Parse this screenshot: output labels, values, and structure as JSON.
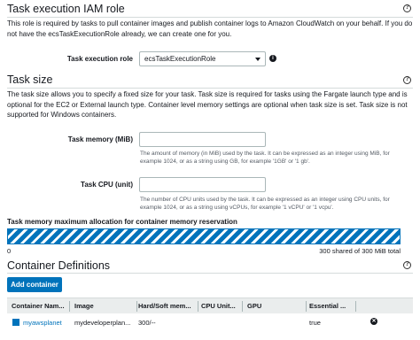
{
  "iam_section": {
    "title": "Task execution IAM role",
    "description": "This role is required by tasks to pull container images and publish container logs to Amazon CloudWatch on your behalf. If you do not have the ecsTaskExecutionRole already, we can create one for you.",
    "field_label": "Task execution role",
    "selected_value": "ecsTaskExecutionRole"
  },
  "task_size": {
    "title": "Task size",
    "description": "The task size allows you to specify a fixed size for your task. Task size is required for tasks using the Fargate launch type and is optional for the EC2 or External launch type. Container level memory settings are optional when task size is set. Task size is not supported for Windows containers.",
    "memory_label": "Task memory (MiB)",
    "memory_value": "",
    "memory_hint": "The amount of memory (in MiB) used by the task. It can be expressed as an integer using MiB, for example 1024, or as a string using GB, for example '1GB' or '1 gb'.",
    "cpu_label": "Task CPU (unit)",
    "cpu_value": "",
    "cpu_hint": "The number of CPU units used by the task. It can be expressed as an integer using CPU units, for example 1024, or as a string using vCPUs, for example '1 vCPU' or '1 vcpu'."
  },
  "memory_bar": {
    "label": "Task memory maximum allocation for container memory reservation",
    "min_label": "0",
    "max_label": "300 shared of 300 MiB total",
    "fill_fraction": 1.0
  },
  "containers": {
    "title": "Container Definitions",
    "add_button": "Add container",
    "columns": [
      "Container Nam...",
      "Image",
      "Hard/Soft mem...",
      "CPU Unit...",
      "GPU",
      "Essential ..."
    ],
    "rows": [
      {
        "name": "myawsplanet",
        "image": "mydeveloperplan...",
        "memory": "300/--",
        "cpu": "",
        "gpu": "",
        "essential": "true"
      }
    ]
  },
  "colors": {
    "accent": "#0073bb",
    "text": "#16191f"
  },
  "icons": [
    "help-icon",
    "info-icon",
    "dropdown-caret-icon",
    "remove-icon"
  ]
}
